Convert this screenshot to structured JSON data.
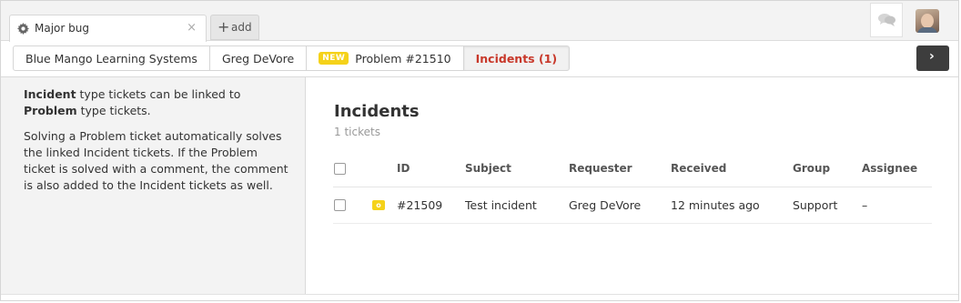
{
  "tabs": {
    "active_title": "Major bug",
    "close_glyph": "×",
    "add_label": "add",
    "add_glyph": "+"
  },
  "breadcrumbs": [
    {
      "label": "Blue Mango Learning Systems"
    },
    {
      "label": "Greg DeVore"
    },
    {
      "badge": "NEW",
      "label": "Problem #21510"
    },
    {
      "label": "Incidents (1)"
    }
  ],
  "next_button": {
    "glyph": "›"
  },
  "sidebar": {
    "p1_bold1": "Incident",
    "p1_text1": " type tickets can be linked to ",
    "p1_bold2": "Problem",
    "p1_text2": " type tickets.",
    "p2": "Solving a Problem ticket automatically solves the linked Incident tickets. If the Problem ticket is solved with a comment, the comment is also added to the Incident tickets as well."
  },
  "main": {
    "title": "Incidents",
    "count": "1 tickets",
    "columns": [
      "ID",
      "Subject",
      "Requester",
      "Received",
      "Group",
      "Assignee"
    ],
    "rows": [
      {
        "status": "o",
        "id": "#21509",
        "subject": "Test incident",
        "requester": "Greg DeVore",
        "received": "12 minutes ago",
        "group": "Support",
        "assignee": "–"
      }
    ]
  },
  "colors": {
    "active_crumb_text": "#c8382a",
    "new_badge": "#f5d21a",
    "open_status": "#f5d21a",
    "next_button_bg": "#3d3d3d",
    "sidebar_bg": "#f3f3f3"
  },
  "icons": [
    "gear-icon",
    "close-icon",
    "plus-icon",
    "chat-bubbles-icon",
    "chevron-right-icon"
  ]
}
